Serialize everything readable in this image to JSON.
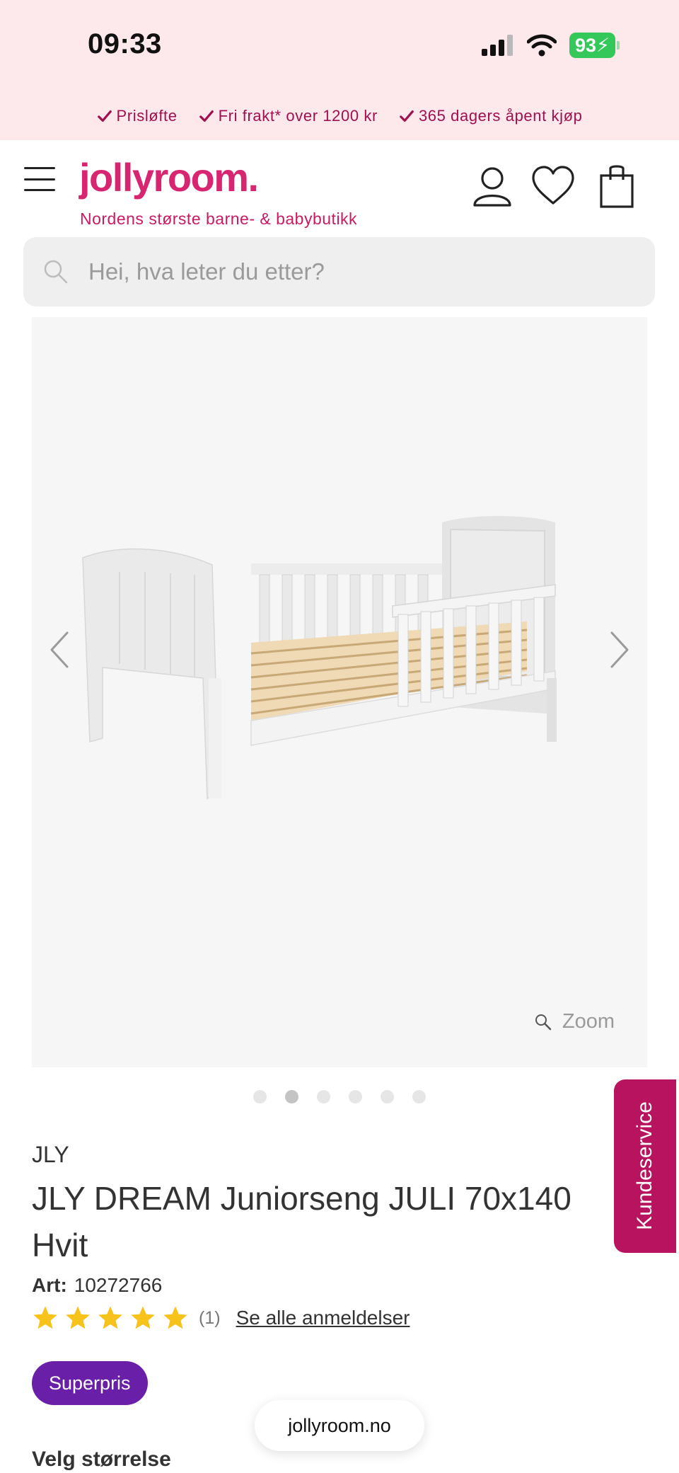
{
  "status_bar": {
    "time": "09:33",
    "battery": "93"
  },
  "usp": [
    "Prisløfte",
    "Fri frakt* over 1200 kr",
    "365 dagers åpent kjøp"
  ],
  "header": {
    "logo": "jollyroom.",
    "tagline": "Nordens største barne- & babybutikk",
    "icons": [
      "account-icon",
      "heart-icon",
      "shopping-bag-icon"
    ]
  },
  "search": {
    "placeholder": "Hei, hva leter du etter?"
  },
  "gallery": {
    "zoom_label": "Zoom",
    "image_count": 6,
    "active_image": 2
  },
  "product": {
    "brand": "JLY",
    "title": "JLY DREAM Juniorseng JULI 70x140 Hvit",
    "art_label": "Art:",
    "art_number": "10272766",
    "rating": 5,
    "review_count": "(1)",
    "reviews_link": "Se alle anmeldelser",
    "badge": "Superpris",
    "size_title": "Velg størrelse"
  },
  "kundeservice": "Kundeservice",
  "url": "jollyroom.no",
  "colors": {
    "brand_pink": "#d8256f",
    "badge_purple": "#6a1fa8",
    "star_yellow": "#f7c21a",
    "kundeservice_bg": "#b8135e"
  }
}
